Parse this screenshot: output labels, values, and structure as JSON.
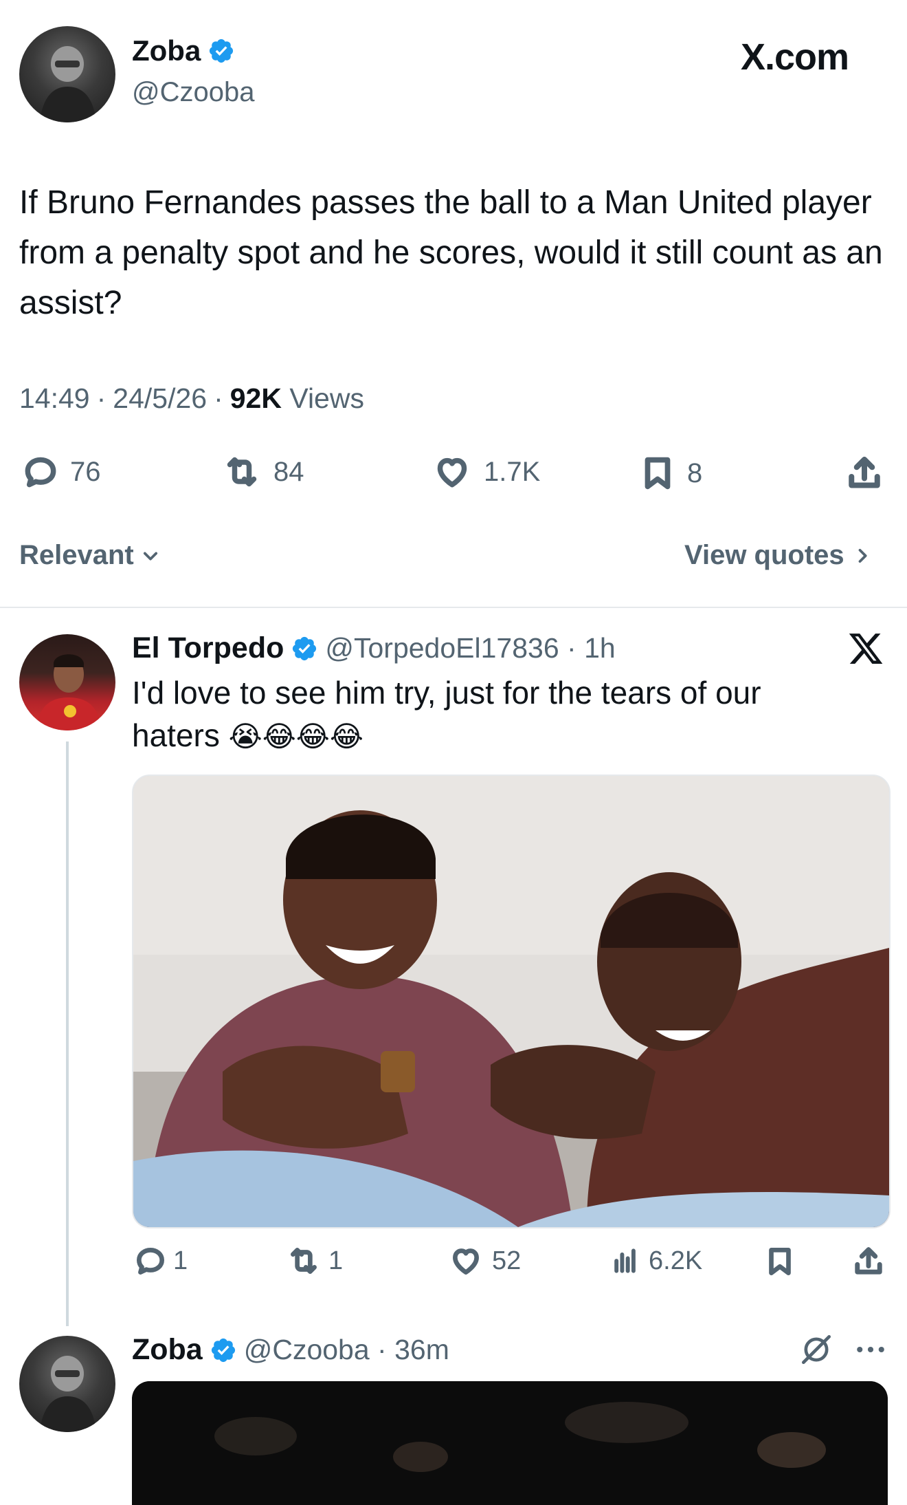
{
  "main_tweet": {
    "author_name": "Zoba",
    "handle": "@Czooba",
    "brand": "X.com",
    "text": "If Bruno Fernandes passes the ball to a Man United player from a penalty spot and he scores, would it still count as an assist?",
    "time": "14:49",
    "sep1": "·",
    "date": "24/5/26",
    "sep2": "·",
    "views_count": "92K",
    "views_label": "Views",
    "replies": "76",
    "reposts": "84",
    "likes": "1.7K",
    "bookmarks": "8"
  },
  "sort_bar": {
    "sort_label": "Relevant",
    "view_quotes": "View quotes"
  },
  "reply1": {
    "author_name": "El Torpedo",
    "handle_time": "@TorpedoEl17836 · 1h",
    "text": "I'd love to see him try, just for the tears of our haters",
    "emojis": "😭😂😂😂",
    "replies": "1",
    "reposts": "1",
    "likes": "52",
    "views": "6.2K"
  },
  "reply2": {
    "author_name": "Zoba",
    "handle_time": "@Czooba · 36m"
  },
  "colors": {
    "text_primary": "#0f1419",
    "text_secondary": "#536471",
    "verified_blue": "#1d9bf0",
    "divider": "#e6e9ec"
  }
}
